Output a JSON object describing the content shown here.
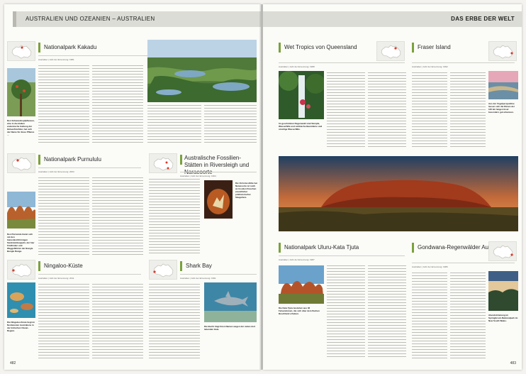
{
  "left_page": {
    "header": "AUSTRALIEN UND OZEANIEN – AUSTRALIEN",
    "page_number": "482",
    "sections": [
      {
        "title": "Nationalpark Kakadu",
        "meta": "Australien | Jahr der Ernennung: 1981",
        "caption": "Den Schwanzkopfpflanzen, eine in Australien endemische Gattung der Hülsenfrüchtler, hat sich der Name für diese Pflanze ..."
      },
      {
        "title": "Nationalpark Purnululu",
        "meta": "Australien | Jahr der Ernennung: 2003",
        "caption": "Den Purnululu bietet sich mit den bienenkorbförmigen Sandsteinkuppeln, der hier Findlinden und Weggefährten der Bungle Bungle Range."
      },
      {
        "title": "Australische Fossilien-Stätten in Riversleigh und Naracoorte",
        "meta": "Australien | Jahr der Ernennung: 1994",
        "caption": "Die Victoria-Höhle bei Naracoorte ist reich an fossilen Knochen eiszeitlicher prähistorischer Säugetiere."
      },
      {
        "title": "Ningaloo-Küste",
        "meta": "Australien | Jahr der Ernennung: 2011",
        "caption": "Die Ningaloo-Küste liegt im Nordwesten Australiens in der Indischen Ozean-Region."
      },
      {
        "title": "Shark Bay",
        "meta": "Australien | Jahr der Ernennung: 1991",
        "caption": "Die Bucht trägt ihren Namen wegen der vielen dort lebenden Haie."
      }
    ]
  },
  "right_page": {
    "header": "DAS ERBE DER WELT",
    "page_number": "483",
    "sections": [
      {
        "title": "Wet Tropics von Queensland",
        "meta": "Australien | Jahr der Ernennung: 1988",
        "caption": "Im geschützten Regenwald sind Sümpfe, Wasserfälle und zahlreiche Baumfarne und urzeitige Wasserfälle."
      },
      {
        "title": "Fraser Island",
        "meta": "Australien | Jahr der Ernennung: 1992",
        "caption": "Aus der Vogelperspektive lassen sich die Dünen der 120 km langen Insel besonders gut erkennen."
      },
      {
        "title": "Nationalpark Uluru-Kata Tjuta",
        "meta": "Australien | Jahr der Ernennung: 1987",
        "caption": "Die Kata Tjuta bestehen aus 36 Felsendomen, die sich über dem flachen Buschland erheben."
      },
      {
        "title": "Gondwana-Regenwälder Australiens",
        "meta": "Australien | Jahr der Ernennung: 1986",
        "caption": "Abendstimmung im Springbrook-Nationalpark im New South Wales."
      }
    ]
  },
  "colors": {
    "header_bg": "#dcdcd6",
    "accent_green": "#7aa23b",
    "map_highlight": "#d93a2b"
  }
}
